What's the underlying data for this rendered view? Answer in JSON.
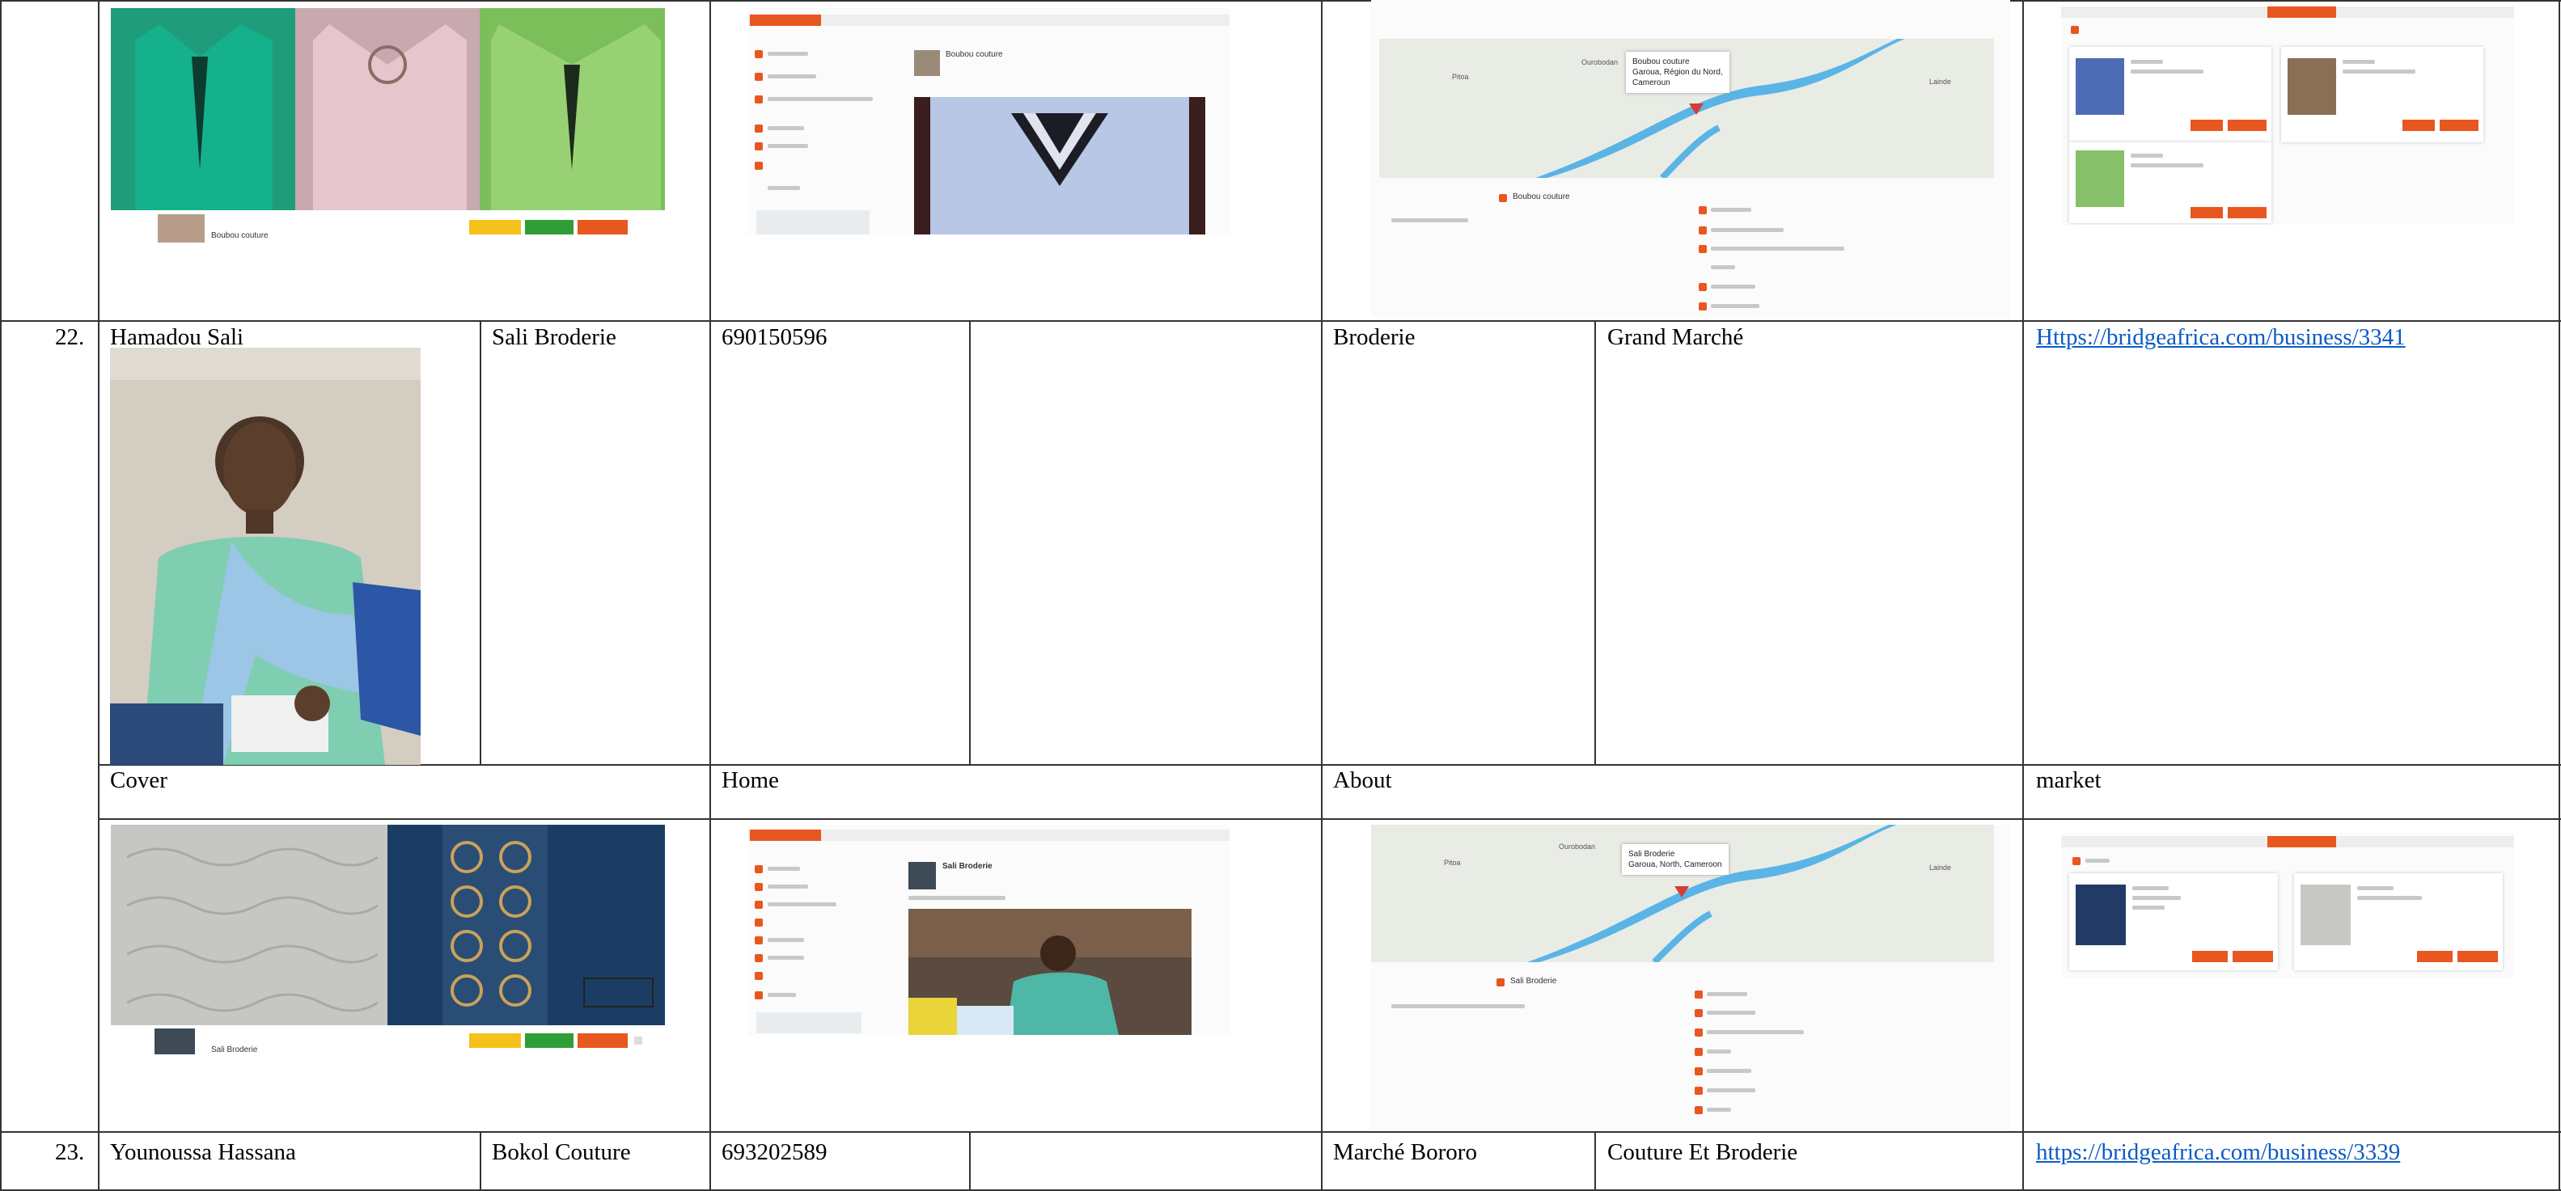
{
  "rows": [
    {
      "number": "22.",
      "name": "Hamadou Sali",
      "business": "Sali Broderie",
      "phone": "690150596",
      "category": "Broderie",
      "location": "Grand Marché",
      "url": "Https://bridgeafrica.com/business/3341",
      "section_labels": {
        "cover": "Cover",
        "home": "Home",
        "about": "About",
        "market": "market"
      },
      "home_name": "Sali Broderie",
      "about_popup": [
        "Sali Broderie",
        "Garoua, North, Cameroon"
      ],
      "about_title": "Sali Broderie"
    },
    {
      "number": "23.",
      "name": "Younoussa Hassana",
      "business": "Bokol Couture",
      "phone": "693202589",
      "category": "Marché Bororo",
      "location": "Couture Et Broderie",
      "url": "https://bridgeafrica.com/business/3339"
    }
  ],
  "previous_row": {
    "cover_name": "Boubou couture",
    "home_name": "Boubou couture",
    "about_popup": [
      "Boubou couture",
      "Garoua, Région du Nord,",
      "Cameroun"
    ],
    "about_title": "Boubou couture"
  },
  "colors": {
    "accent": "#e8571f",
    "link": "#0b5bc4",
    "river": "#5ab4e6"
  }
}
